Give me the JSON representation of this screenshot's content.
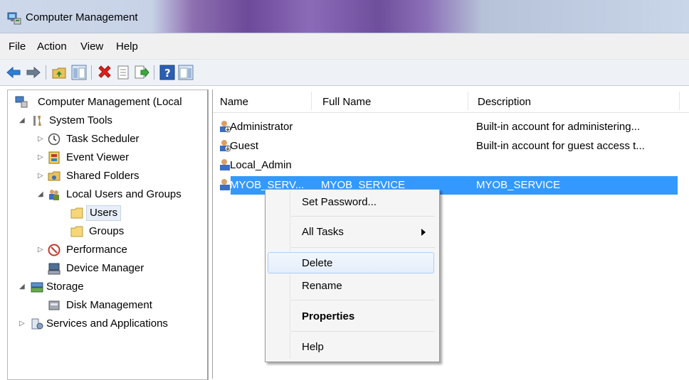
{
  "window": {
    "title": "Computer Management"
  },
  "menu": [
    "File",
    "Action",
    "View",
    "Help"
  ],
  "toolbar": {
    "icons": [
      "back-arrow-icon",
      "forward-arrow-icon",
      "up-folder-icon",
      "show-hide-tree-icon",
      "delete-icon",
      "properties-icon",
      "export-list-icon",
      "help-icon",
      "action-pane-icon"
    ],
    "accent": "#2e7fd6"
  },
  "tree": {
    "root": "Computer Management (Local",
    "system_tools": "System Tools",
    "task_scheduler": "Task Scheduler",
    "event_viewer": "Event Viewer",
    "shared_folders": "Shared Folders",
    "local_users": "Local Users and Groups",
    "users": "Users",
    "groups": "Groups",
    "performance": "Performance",
    "device_manager": "Device Manager",
    "storage": "Storage",
    "disk_management": "Disk Management",
    "services": "Services and Applications"
  },
  "list": {
    "columns": {
      "name": "Name",
      "full_name": "Full Name",
      "description": "Description"
    },
    "rows": [
      {
        "name": "Administrator",
        "full_name": "",
        "description": "Built-in account for administering..."
      },
      {
        "name": "Guest",
        "full_name": "",
        "description": "Built-in account for guest access t..."
      },
      {
        "name": "Local_Admin",
        "full_name": "",
        "description": ""
      },
      {
        "name": "MYOB_SERV...",
        "full_name": "MYOB_SERVICE",
        "description": "MYOB_SERVICE"
      }
    ],
    "selection_color": "#3399ff"
  },
  "context_menu": {
    "set_password": "Set Password...",
    "all_tasks": "All Tasks",
    "delete": "Delete",
    "rename": "Rename",
    "properties": "Properties",
    "help": "Help"
  }
}
